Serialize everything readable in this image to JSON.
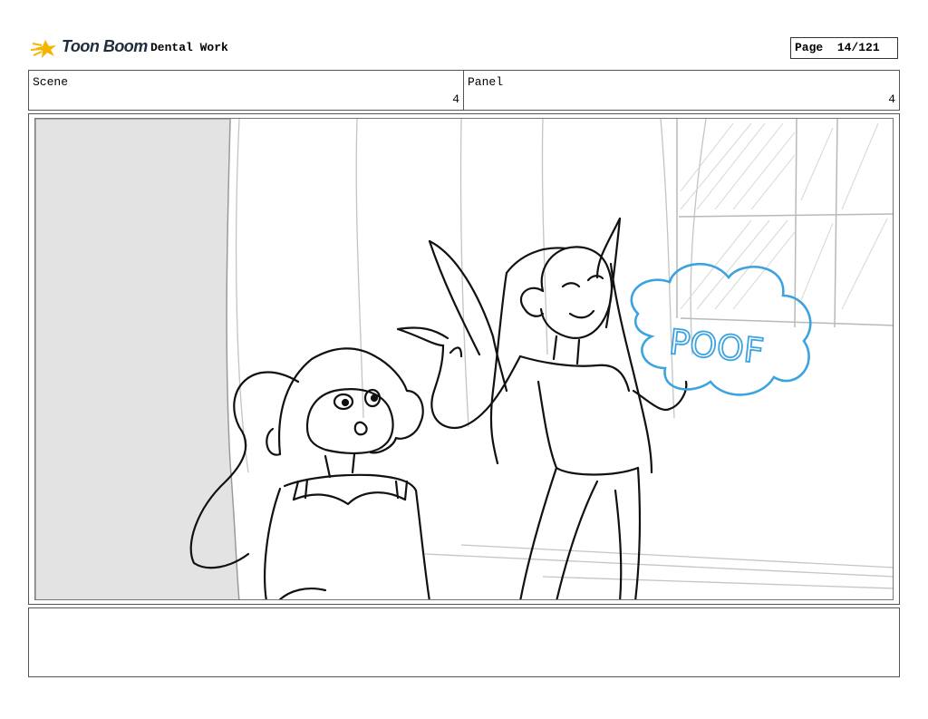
{
  "header": {
    "logo_text": "Toon Boom",
    "document_title": "Dental Work",
    "page_label": "Page",
    "page_value": "14/121"
  },
  "scene": {
    "label": "Scene",
    "value": "4"
  },
  "panel": {
    "label": "Panel",
    "value": "4"
  },
  "artwork": {
    "sound_effect_text": "POOF",
    "effect_color": "#3aa3e0"
  },
  "notes": {
    "text": ""
  }
}
